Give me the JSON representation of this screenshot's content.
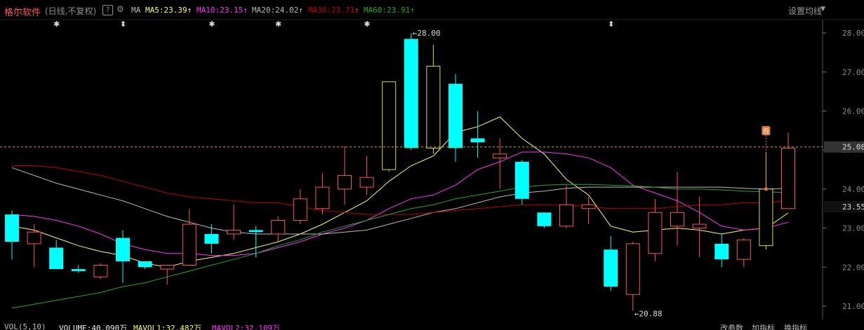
{
  "header": {
    "stock_name": "格尔软件",
    "period": "(日线,不复权)",
    "help_icon": "?",
    "gear_icon": "gear-icon",
    "ma_label": "MA",
    "ma_values": [
      {
        "label": "MA5:23.39",
        "arrow": "↑",
        "color": "#ffff66"
      },
      {
        "label": "MA10:23.15",
        "arrow": "↑",
        "color": "#ff33ff"
      },
      {
        "label": "MA20:24.02",
        "arrow": "↑",
        "color": "#bbbbbb"
      },
      {
        "label": "MA30:23.71",
        "arrow": "↑",
        "color": "#c00000"
      },
      {
        "label": "MA60:23.91",
        "arrow": "↑",
        "color": "#22aa22"
      }
    ],
    "settings_label": "设置均线"
  },
  "markers": {
    "star": "✱",
    "updown": "⬍",
    "self_badge": "自"
  },
  "price_axis": {
    "ticks": [
      "28.00",
      "27.00",
      "26.00",
      "25.00",
      "24.00",
      "23.00",
      "22.00",
      "21.00"
    ],
    "current_price": "25.08",
    "ma_tag": "23.55"
  },
  "annotations": {
    "high": "28.00",
    "low": "20.88"
  },
  "footer": {
    "vol_label": "VOL(5,10)",
    "volume": "VOLUME:40.090万",
    "mavol1": "MAVOL1:32.482万",
    "mavol2": "MAVOL2:32.109万",
    "btn_params": "改参数",
    "btn_add": "加指标",
    "btn_switch": "换指标"
  },
  "chart_data": {
    "type": "candlestick",
    "ylim": [
      20.8,
      28.2
    ],
    "colors": {
      "up": "#ff5555",
      "down": "#00ffff",
      "up_yellow": "#dddd33"
    },
    "candles": [
      {
        "o": 23.35,
        "h": 23.45,
        "l": 22.2,
        "c": 22.65,
        "dir": "down"
      },
      {
        "o": 22.6,
        "h": 23.1,
        "l": 22.0,
        "c": 22.9,
        "dir": "up"
      },
      {
        "o": 22.5,
        "h": 22.7,
        "l": 21.95,
        "c": 21.95,
        "dir": "down"
      },
      {
        "o": 21.95,
        "h": 22.05,
        "l": 21.85,
        "c": 21.9,
        "dir": "down"
      },
      {
        "o": 21.75,
        "h": 22.1,
        "l": 21.7,
        "c": 22.05,
        "dir": "up"
      },
      {
        "o": 22.75,
        "h": 22.95,
        "l": 21.6,
        "c": 22.15,
        "dir": "down"
      },
      {
        "o": 22.15,
        "h": 22.15,
        "l": 21.95,
        "c": 22.0,
        "dir": "down"
      },
      {
        "o": 21.95,
        "h": 22.05,
        "l": 21.55,
        "c": 22.05,
        "dir": "up"
      },
      {
        "o": 22.05,
        "h": 23.5,
        "l": 22.05,
        "c": 23.1,
        "dir": "up"
      },
      {
        "o": 22.85,
        "h": 23.1,
        "l": 22.35,
        "c": 22.6,
        "dir": "down"
      },
      {
        "o": 22.85,
        "h": 23.6,
        "l": 22.7,
        "c": 22.95,
        "dir": "up"
      },
      {
        "o": 22.9,
        "h": 23.05,
        "l": 22.25,
        "c": 22.95,
        "dir": "down"
      },
      {
        "o": 22.85,
        "h": 23.3,
        "l": 22.65,
        "c": 23.2,
        "dir": "up"
      },
      {
        "o": 23.2,
        "h": 24.0,
        "l": 23.1,
        "c": 23.75,
        "dir": "up"
      },
      {
        "o": 23.5,
        "h": 24.4,
        "l": 23.35,
        "c": 24.05,
        "dir": "up"
      },
      {
        "o": 24.0,
        "h": 25.1,
        "l": 23.6,
        "c": 24.35,
        "dir": "up"
      },
      {
        "o": 24.05,
        "h": 24.85,
        "l": 23.85,
        "c": 24.3,
        "dir": "up"
      },
      {
        "o": 24.5,
        "h": 24.5,
        "l": 24.45,
        "c": 26.75,
        "dir": "up_yellow"
      },
      {
        "o": 27.85,
        "h": 28.0,
        "l": 25.0,
        "c": 25.05,
        "dir": "down"
      },
      {
        "o": 25.05,
        "h": 27.7,
        "l": 24.9,
        "c": 27.15,
        "dir": "up_yellow"
      },
      {
        "o": 26.7,
        "h": 26.95,
        "l": 24.7,
        "c": 25.05,
        "dir": "down"
      },
      {
        "o": 25.3,
        "h": 26.0,
        "l": 24.8,
        "c": 25.2,
        "dir": "down"
      },
      {
        "o": 24.9,
        "h": 25.3,
        "l": 24.0,
        "c": 24.8,
        "dir": "up"
      },
      {
        "o": 24.7,
        "h": 24.75,
        "l": 23.6,
        "c": 23.75,
        "dir": "down"
      },
      {
        "o": 23.4,
        "h": 23.4,
        "l": 23.0,
        "c": 23.05,
        "dir": "down"
      },
      {
        "o": 23.05,
        "h": 24.1,
        "l": 23.0,
        "c": 23.6,
        "dir": "up"
      },
      {
        "o": 23.5,
        "h": 23.8,
        "l": 23.1,
        "c": 23.6,
        "dir": "up"
      },
      {
        "o": 22.45,
        "h": 22.8,
        "l": 21.4,
        "c": 21.5,
        "dir": "down"
      },
      {
        "o": 21.3,
        "h": 22.65,
        "l": 20.88,
        "c": 22.6,
        "dir": "up"
      },
      {
        "o": 22.35,
        "h": 23.75,
        "l": 22.15,
        "c": 23.4,
        "dir": "up"
      },
      {
        "o": 23.05,
        "h": 24.45,
        "l": 22.55,
        "c": 23.4,
        "dir": "up"
      },
      {
        "o": 23.0,
        "h": 23.8,
        "l": 22.25,
        "c": 23.1,
        "dir": "up"
      },
      {
        "o": 22.6,
        "h": 22.85,
        "l": 22.0,
        "c": 22.2,
        "dir": "down"
      },
      {
        "o": 22.2,
        "h": 22.75,
        "l": 22.0,
        "c": 22.7,
        "dir": "up"
      },
      {
        "o": 22.55,
        "h": 24.95,
        "l": 22.45,
        "c": 24.0,
        "dir": "up_yellow"
      },
      {
        "o": 23.5,
        "h": 25.45,
        "l": 23.5,
        "c": 25.05,
        "dir": "up"
      }
    ],
    "series": [
      {
        "name": "MA5",
        "color": "#ffff66",
        "values": [
          23.05,
          22.95,
          22.75,
          22.55,
          22.4,
          22.3,
          22.1,
          22.0,
          22.15,
          22.25,
          22.35,
          22.5,
          22.65,
          22.85,
          23.1,
          23.4,
          23.7,
          24.2,
          24.6,
          24.85,
          25.45,
          25.6,
          25.85,
          25.3,
          24.9,
          24.25,
          23.85,
          23.05,
          22.9,
          22.95,
          23.0,
          22.95,
          22.85,
          22.95,
          23.0,
          23.39
        ]
      },
      {
        "name": "MA10",
        "color": "#ff33ff",
        "values": [
          23.35,
          23.3,
          23.2,
          23.05,
          22.85,
          22.6,
          22.45,
          22.35,
          22.35,
          22.3,
          22.3,
          22.35,
          22.5,
          22.65,
          22.85,
          23.0,
          23.2,
          23.5,
          23.75,
          23.85,
          24.1,
          24.5,
          24.7,
          24.95,
          24.95,
          24.9,
          24.8,
          24.55,
          24.1,
          23.9,
          23.7,
          23.4,
          23.05,
          22.95,
          23.0,
          23.15
        ]
      },
      {
        "name": "MA20",
        "color": "#bbbbbb",
        "values": [
          24.55,
          24.35,
          24.15,
          24.0,
          23.85,
          23.7,
          23.5,
          23.3,
          23.15,
          23.0,
          22.9,
          22.85,
          22.85,
          22.85,
          22.85,
          22.9,
          22.95,
          23.1,
          23.25,
          23.4,
          23.5,
          23.65,
          23.8,
          23.9,
          23.95,
          24.02,
          24.05,
          24.05,
          24.05,
          24.05,
          24.05,
          24.05,
          24.05,
          24.02,
          24.0,
          24.02
        ]
      },
      {
        "name": "MA30",
        "color": "#c00000",
        "values": [
          24.6,
          24.6,
          24.55,
          24.45,
          24.35,
          24.2,
          24.05,
          23.9,
          23.8,
          23.75,
          23.7,
          23.65,
          23.65,
          23.55,
          23.45,
          23.4,
          23.35,
          23.35,
          23.35,
          23.4,
          23.45,
          23.5,
          23.55,
          23.6,
          23.6,
          23.6,
          23.55,
          23.5,
          23.5,
          23.5,
          23.55,
          23.6,
          23.6,
          23.65,
          23.65,
          23.71
        ]
      },
      {
        "name": "MA60",
        "color": "#22aa22",
        "values": [
          20.95,
          21.05,
          21.15,
          21.25,
          21.35,
          21.5,
          21.6,
          21.75,
          21.9,
          22.05,
          22.2,
          22.35,
          22.55,
          22.7,
          22.9,
          23.05,
          23.2,
          23.35,
          23.5,
          23.6,
          23.75,
          23.85,
          23.95,
          24.05,
          24.1,
          24.12,
          24.12,
          24.1,
          24.08,
          24.05,
          24.0,
          24.0,
          23.98,
          23.95,
          23.93,
          23.91
        ]
      }
    ]
  }
}
